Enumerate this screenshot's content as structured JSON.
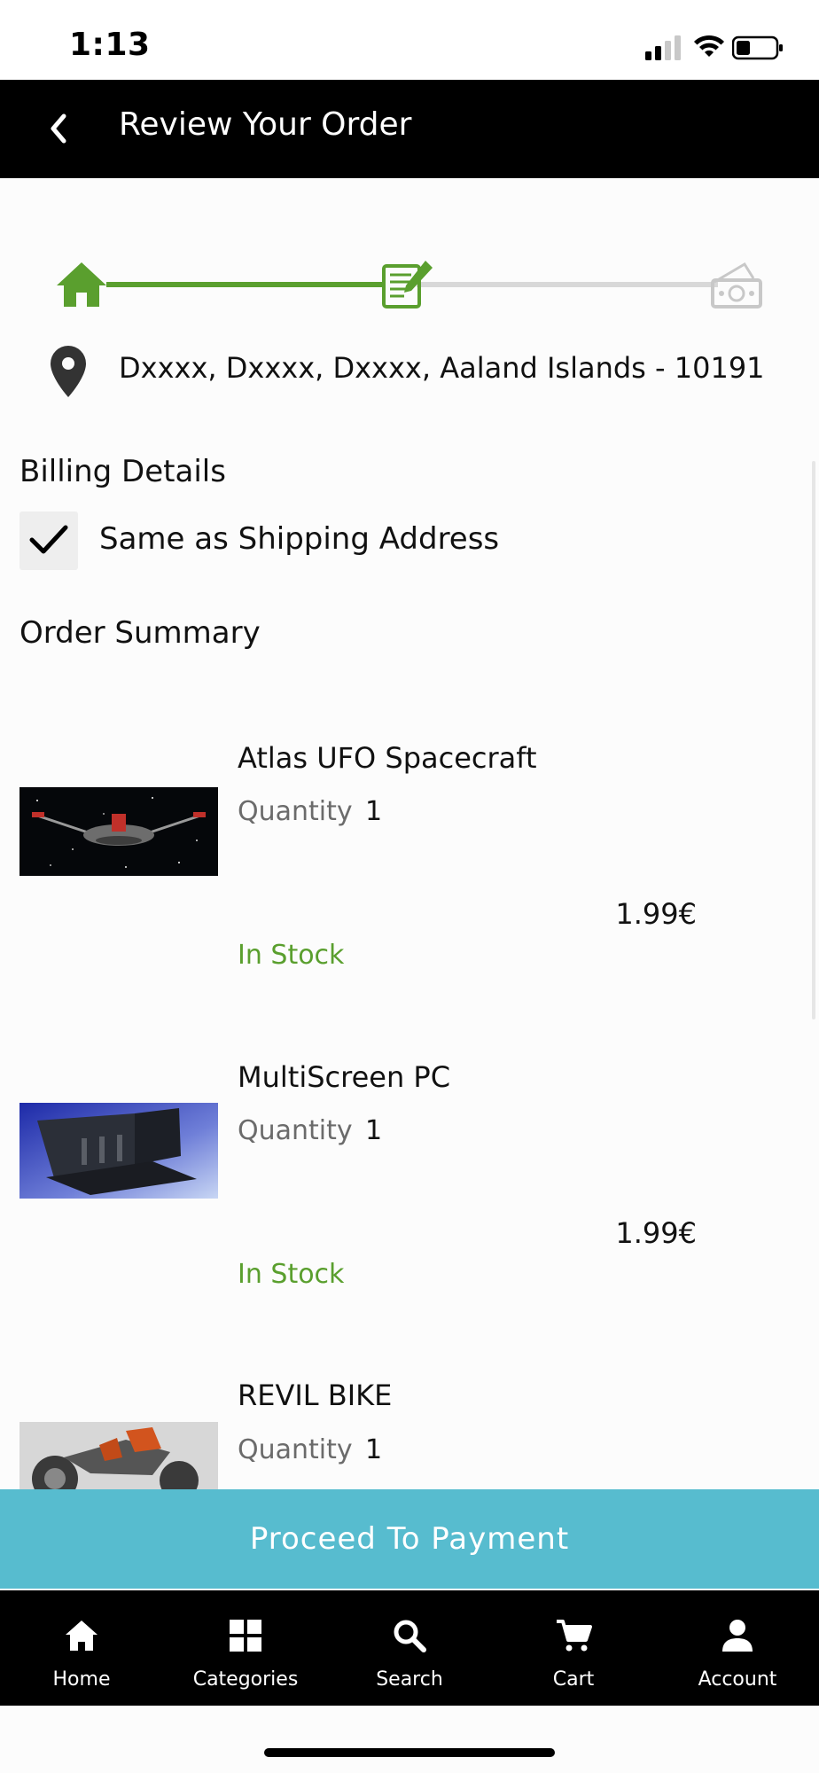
{
  "status_bar": {
    "time": "1:13"
  },
  "header": {
    "title": "Review Your Order"
  },
  "progress": {
    "steps": [
      "home",
      "review",
      "payment"
    ],
    "current": 2,
    "active_color": "#5a9f2e",
    "inactive_color": "#d8d8d8"
  },
  "shipping": {
    "address": "Dxxxx, Dxxxx, Dxxxx, Aaland Islands - 10191"
  },
  "billing": {
    "title": "Billing Details",
    "same_as_shipping_label": "Same as Shipping Address",
    "checked": true
  },
  "order_summary": {
    "title": "Order Summary",
    "quantity_label": "Quantity",
    "items": [
      {
        "name": "Atlas UFO Spacecraft",
        "quantity": "1",
        "price": "1.99€",
        "stock": "In Stock"
      },
      {
        "name": "MultiScreen PC",
        "quantity": "1",
        "price": "1.99€",
        "stock": "In Stock"
      },
      {
        "name": "REVIL BIKE",
        "quantity": "1"
      }
    ]
  },
  "proceed_button": {
    "label": "Proceed To Payment",
    "color": "#57bccf"
  },
  "tab_bar": {
    "tabs": [
      {
        "label": "Home",
        "icon": "home-icon"
      },
      {
        "label": "Categories",
        "icon": "grid-icon"
      },
      {
        "label": "Search",
        "icon": "search-icon"
      },
      {
        "label": "Cart",
        "icon": "cart-icon"
      },
      {
        "label": "Account",
        "icon": "person-icon"
      }
    ]
  }
}
